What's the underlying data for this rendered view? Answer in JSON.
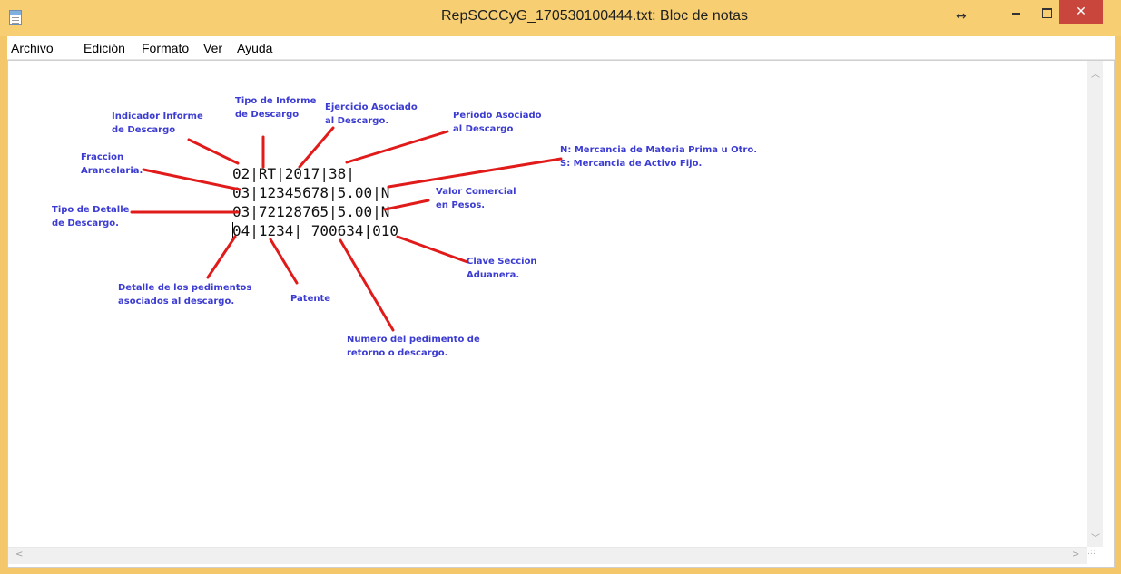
{
  "window": {
    "title": "RepSCCCyG_170530100444.txt: Bloc de notas",
    "close_glyph": "✕",
    "resize_glyph": "↔"
  },
  "menu": {
    "items": [
      "Archivo",
      "Edición",
      "Formato",
      "Ver",
      "Ayuda"
    ]
  },
  "editor": {
    "lines": [
      "02|RT|2017|38|",
      "03|12345678|5.00|N",
      "03|72128765|5.00|N",
      "04|1234| 700634|010"
    ]
  },
  "annotations": {
    "tipo_informe": "Tipo de Informe\nde Descargo",
    "indicador_informe": "Indicador Informe\nde Descargo",
    "ejercicio": "Ejercicio Asociado\nal Descargo.",
    "periodo": "Periodo Asociado\nal Descargo",
    "mercancia": "N: Mercancia de Materia Prima u Otro.\nS: Mercancia de Activo Fijo.",
    "fraccion": "Fraccion\nArancelaria.",
    "valor_comercial": "Valor Comercial\nen Pesos.",
    "tipo_detalle": "Tipo de Detalle\nde Descargo.",
    "clave_seccion": "Clave Seccion\nAduanera.",
    "detalle_pedimentos": "Detalle de los pedimentos\nasociados al descargo.",
    "patente": "Patente",
    "numero_pedimento": "Numero del pedimento de\nretorno o descargo."
  },
  "colors": {
    "title_bar": "#f7cf72",
    "close_button": "#c9463d",
    "annotation_text": "#3c3cd2",
    "annotation_line": "#e11a1a"
  }
}
